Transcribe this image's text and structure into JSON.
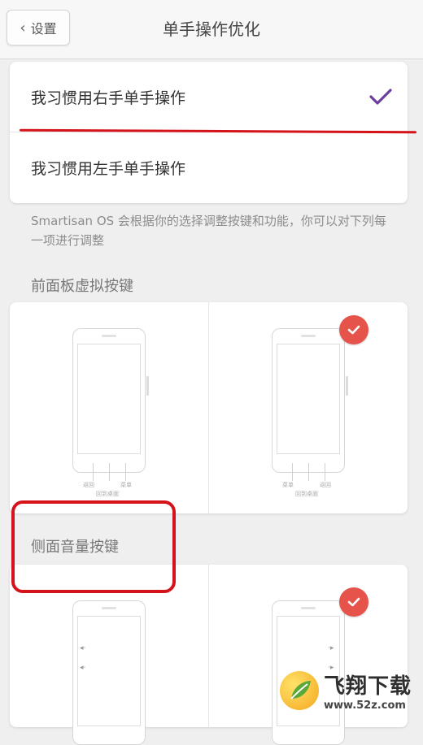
{
  "navbar": {
    "back_label": "设置",
    "title": "单手操作优化"
  },
  "hand_options": [
    {
      "label": "我习惯用右手单手操作",
      "selected": true
    },
    {
      "label": "我习惯用左手单手操作",
      "selected": false
    }
  ],
  "description": "Smartisan OS 会根据你的选择调整按键和功能，你可以对下列每一项进行调整",
  "sections": {
    "front_panel": {
      "title": "前面板虚拟按键",
      "options": [
        {
          "keys": [
            "返回",
            "菜单"
          ],
          "home": "回到桌面",
          "selected": false
        },
        {
          "keys": [
            "菜单",
            "返回"
          ],
          "home": "回到桌面",
          "selected": true
        }
      ]
    },
    "side_volume": {
      "title": "侧面音量按键",
      "options": [
        {
          "selected": false
        },
        {
          "selected": true
        }
      ]
    }
  },
  "colors": {
    "check_purple": "#6b3fa0",
    "badge_red": "#e5534b",
    "annotation_red": "#d4131a"
  },
  "watermark": {
    "name": "飞翔下载",
    "url": "www.52z.com"
  }
}
